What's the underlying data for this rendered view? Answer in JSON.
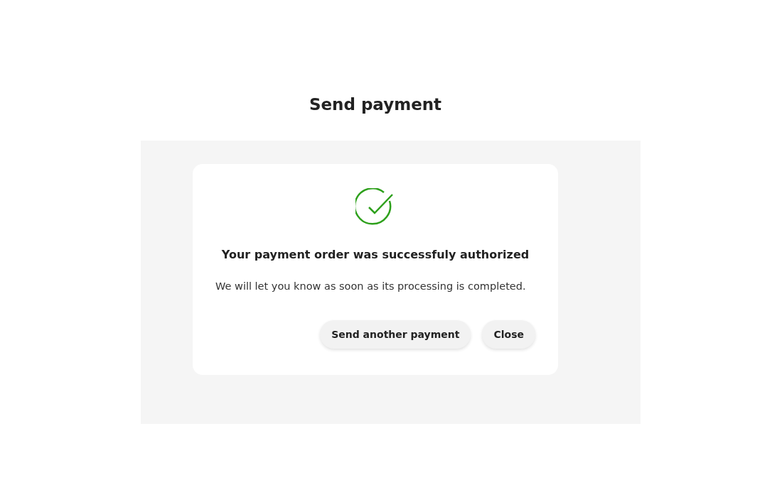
{
  "page": {
    "title": "Send payment"
  },
  "dialog": {
    "heading": "Your payment order was successfuly authorized",
    "message": "We will let you know as soon as its processing is completed.",
    "buttons": [
      "Send another payment",
      "Close"
    ]
  }
}
